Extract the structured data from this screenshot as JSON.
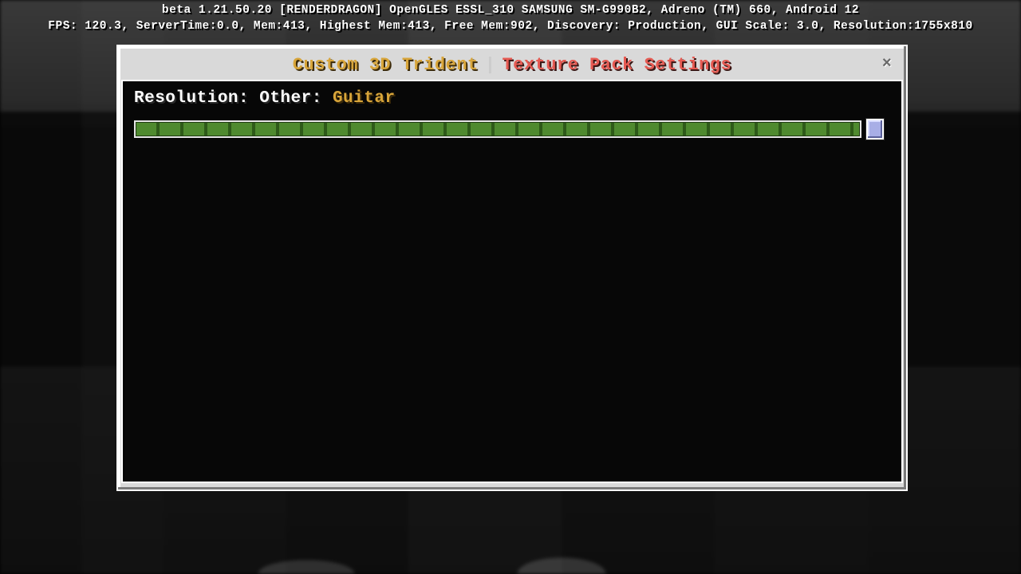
{
  "debug": {
    "line1": "beta 1.21.50.20 [RENDERDRAGON] OpenGLES ESSL_310 SAMSUNG SM-G990B2, Adreno (TM) 660, Android 12",
    "line2": "FPS: 120.3, ServerTime:0.0, Mem:413, Highest Mem:413, Free Mem:902, Discovery: Production, GUI Scale: 3.0, Resolution:1755x810"
  },
  "panel": {
    "title_left": "Custom 3D Trident",
    "title_separator": "|",
    "title_right": "Texture Pack Settings",
    "close_glyph": "×"
  },
  "setting": {
    "label_prefix": "Resolution: Other: ",
    "value": "Guitar"
  },
  "colors": {
    "accent_gold": "#d8a53a",
    "accent_red": "#e65a52",
    "track_green": "#4f8a2f",
    "thumb_blue": "#a8aee6"
  }
}
